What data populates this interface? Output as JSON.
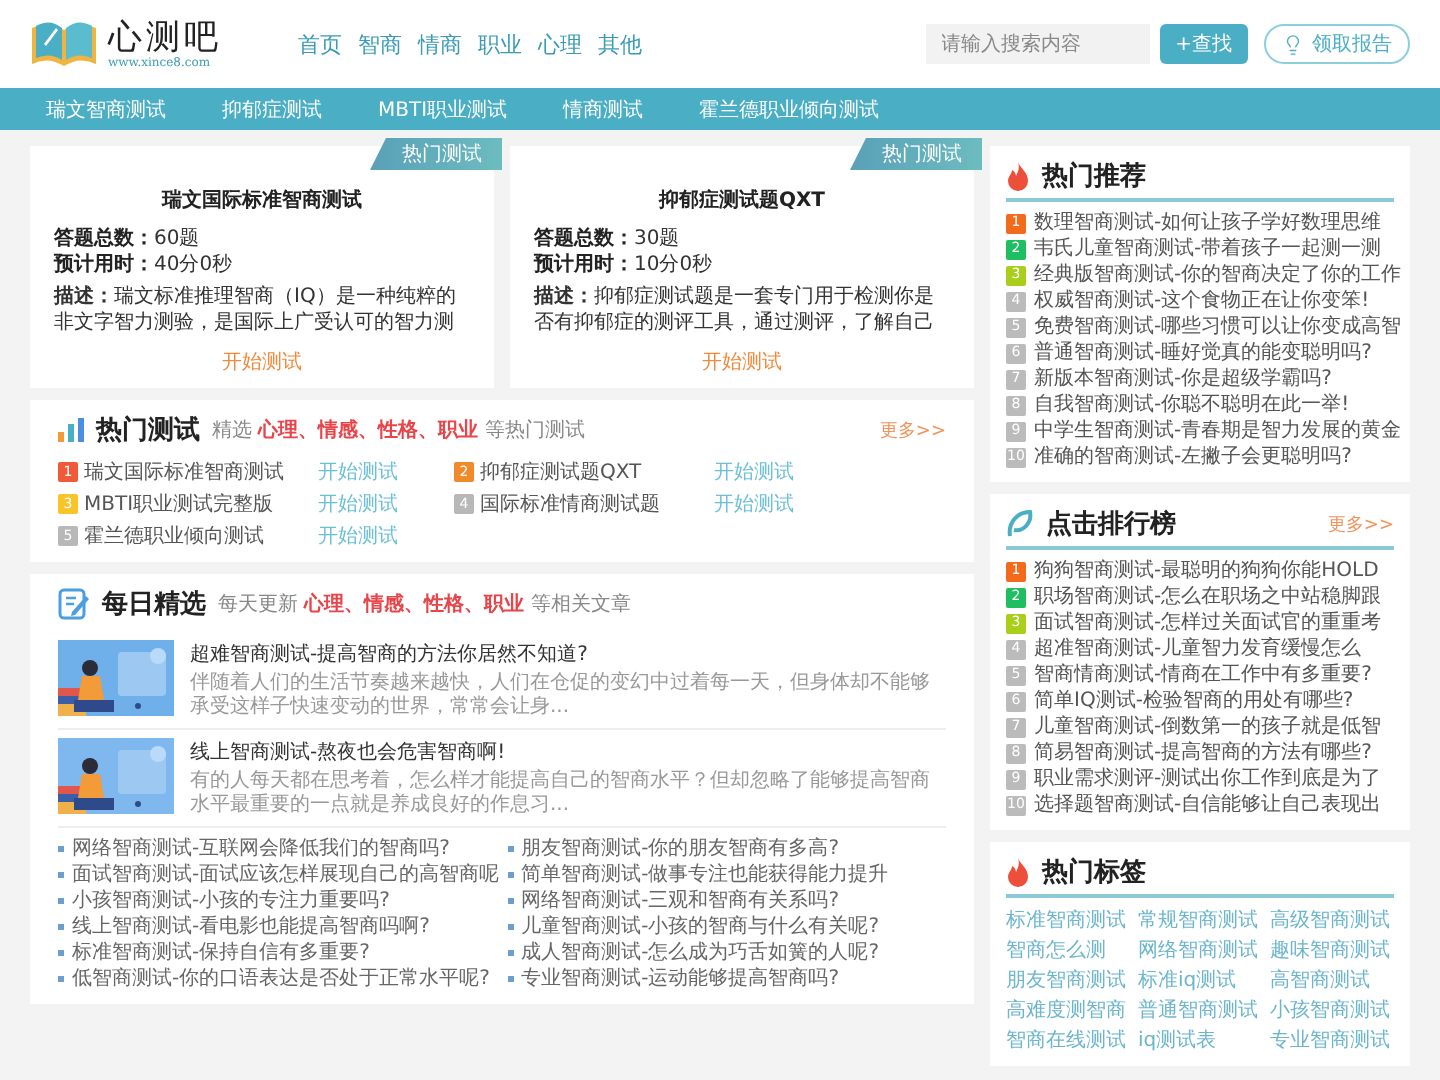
{
  "header": {
    "logo_title": "心测吧",
    "logo_url": "www.xince8.com",
    "nav": [
      "首页",
      "智商",
      "情商",
      "职业",
      "心理",
      "其他"
    ],
    "search": {
      "placeholder": "请输入搜索内容"
    },
    "search_button": "+查找",
    "report_button": "领取报告"
  },
  "category_bar": [
    "瑞文智商测试",
    "抑郁症测试",
    "MBTI职业测试",
    "情商测试",
    "霍兰德职业倾向测试"
  ],
  "featured_tests": [
    {
      "ribbon": "热门测试",
      "title": "瑞文国际标准智商测试",
      "stats": [
        {
          "label": "答题总数：",
          "value": "60题"
        },
        {
          "label": "预计用时：",
          "value": "40分0秒"
        }
      ],
      "description_label": "描述：",
      "description": "瑞文标准推理智商（IQ）是一种纯粹的非文字智力测验，是国际上广受认可的智力测",
      "action": "开始测试"
    },
    {
      "ribbon": "热门测试",
      "title": "抑郁症测试题QXT",
      "stats": [
        {
          "label": "答题总数：",
          "value": "30题"
        },
        {
          "label": "预计用时：",
          "value": "10分0秒"
        }
      ],
      "description_label": "描述：",
      "description": "抑郁症测试题是一套专门用于检测你是否有抑郁症的测评工具，通过测评，了解自己",
      "action": "开始测试"
    }
  ],
  "hot_tests": {
    "title": "热门测试",
    "subtitle": "精选 **心理、情感、性格、职业** 等热门测试",
    "more": "更多>>",
    "items": [
      {
        "rank": "1",
        "name": "瑞文国际标准智商测试",
        "action": "开始测试",
        "color": "#f05a3a"
      },
      {
        "rank": "2",
        "name": "抑郁症测试题QXT",
        "action": "开始测试",
        "color": "#f08a2a"
      },
      {
        "rank": "3",
        "name": "MBTI职业测试完整版",
        "action": "开始测试",
        "color": "#f8c42a"
      },
      {
        "rank": "4",
        "name": "国际标准情商测试题",
        "action": "开始测试",
        "color": "#b8b8b8"
      },
      {
        "rank": "5",
        "name": "霍兰德职业倾向测试",
        "action": "开始测试",
        "color": "#b8b8b8"
      }
    ]
  },
  "daily": {
    "title": "每日精选",
    "subtitle": "每天更新 **心理、情感、性格、职业** 等相关文章",
    "articles": [
      {
        "kind": "picture",
        "title": "超难智商测试-提高智商的方法你居然不知道?",
        "excerpt": "伴随着人们的生活节奏越来越快，人们在仓促的变幻中过着每一天，但身体却不能够承受这样子快速变动的世界，常常会让身..."
      },
      {
        "kind": "picture",
        "title": "线上智商测试-熬夜也会危害智商啊!",
        "excerpt": "有的人每天都在思考着，怎么样才能提高自己的智商水平？但却忽略了能够提高智商水平最重要的一点就是养成良好的作息习..."
      }
    ],
    "links": [
      "网络智商测试-互联网会降低我们的智商吗?",
      "朋友智商测试-你的朋友智商有多高?",
      "面试智商测试-面试应该怎样展现自己的高智商呢",
      "简单智商测试-做事专注也能获得能力提升",
      "小孩智商测试-小孩的专注力重要吗?",
      "网络智商测试-三观和智商有关系吗?",
      "线上智商测试-看电影也能提高智商吗啊?",
      "儿童智商测试-小孩的智商与什么有关呢?",
      "标准智商测试-保持自信有多重要?",
      "成人智商测试-怎么成为巧舌如簧的人呢?",
      "低智商测试-你的口语表达是否处于正常水平呢?",
      "专业智商测试-运动能够提高智商吗?"
    ]
  },
  "hot_recommend": {
    "title": "热门推荐",
    "items": [
      {
        "rank": "1",
        "text": "数理智商测试-如何让孩子学好数理思维",
        "color": "#f26b1d"
      },
      {
        "rank": "2",
        "text": "韦氏儿童智商测试-带着孩子一起测一测",
        "color": "#1dbf60"
      },
      {
        "rank": "3",
        "text": "经典版智商测试-你的智商决定了你的工作",
        "color": "#a9cf1a"
      },
      {
        "rank": "4",
        "text": "权威智商测试-这个食物正在让你变笨!",
        "color": "#bbbbbb"
      },
      {
        "rank": "5",
        "text": "免费智商测试-哪些习惯可以让你变成高智",
        "color": "#bbbbbb"
      },
      {
        "rank": "6",
        "text": "普通智商测试-睡好觉真的能变聪明吗?",
        "color": "#bbbbbb"
      },
      {
        "rank": "7",
        "text": "新版本智商测试-你是超级学霸吗?",
        "color": "#bbbbbb"
      },
      {
        "rank": "8",
        "text": "自我智商测试-你聪不聪明在此一举!",
        "color": "#bbbbbb"
      },
      {
        "rank": "9",
        "text": "中学生智商测试-青春期是智力发展的黄金",
        "color": "#bbbbbb"
      },
      {
        "rank": "10",
        "text": "准确的智商测试-左撇子会更聪明吗?",
        "color": "#bbbbbb"
      }
    ]
  },
  "ranking": {
    "title": "点击排行榜",
    "more": "更多>>",
    "items": [
      {
        "rank": "1",
        "text": "狗狗智商测试-最聪明的狗狗你能HOLD",
        "color": "#f26b1d"
      },
      {
        "rank": "2",
        "text": "职场智商测试-怎么在职场之中站稳脚跟",
        "color": "#1dbf60"
      },
      {
        "rank": "3",
        "text": "面试智商测试-怎样过关面试官的重重考",
        "color": "#a9cf1a"
      },
      {
        "rank": "4",
        "text": "超准智商测试-儿童智力发育缓慢怎么",
        "color": "#bbbbbb"
      },
      {
        "rank": "5",
        "text": "智商情商测试-情商在工作中有多重要?",
        "color": "#bbbbbb"
      },
      {
        "rank": "6",
        "text": "简单IQ测试-检验智商的用处有哪些?",
        "color": "#bbbbbb"
      },
      {
        "rank": "7",
        "text": "儿童智商测试-倒数第一的孩子就是低智",
        "color": "#bbbbbb"
      },
      {
        "rank": "8",
        "text": "简易智商测试-提高智商的方法有哪些?",
        "color": "#bbbbbb"
      },
      {
        "rank": "9",
        "text": "职业需求测评-测试出你工作到底是为了",
        "color": "#bbbbbb"
      },
      {
        "rank": "10",
        "text": "选择题智商测试-自信能够让自己表现出",
        "color": "#bbbbbb"
      }
    ]
  },
  "tags": {
    "title": "热门标签",
    "items": [
      "标准智商测试",
      "常规智商测试",
      "高级智商测试",
      "智商怎么测",
      "网络智商测试",
      "趣味智商测试",
      "朋友智商测试",
      "标准iq测试",
      "高智商测试",
      "高难度测智商",
      "普通智商测试",
      "小孩智商测试",
      "智商在线测试",
      "iq测试表",
      "专业智商测试"
    ]
  }
}
